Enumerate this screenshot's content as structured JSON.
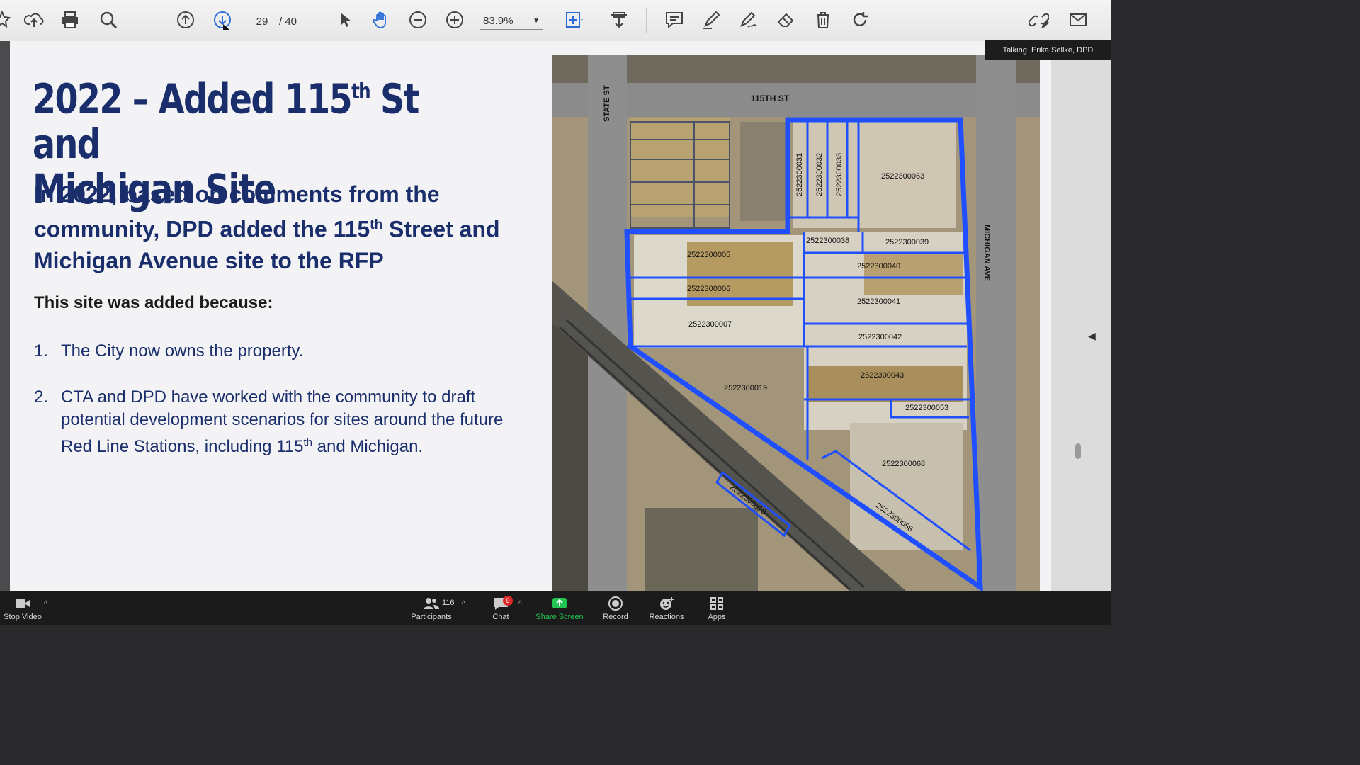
{
  "toolbar": {
    "page_current": "29",
    "page_total": "/ 40",
    "zoom": "83.9%"
  },
  "talking_indicator": "Talking: Erika Sellke, DPD",
  "slide": {
    "title_line1_a": "2022 – Added 115",
    "title_line1_sup": "th",
    "title_line1_b": " St and",
    "title_line2": "Michigan Site",
    "subtitle_a": "In 2022, based on comments from the community, DPD added the 115",
    "subtitle_sup": "th",
    "subtitle_b": " Street and Michigan Avenue site to the RFP",
    "reasons_heading": "This site was added because:",
    "reasons": [
      {
        "num": "1.",
        "text": "The City now owns the property."
      },
      {
        "num": "2.",
        "text_a": "CTA and DPD have worked with the community to draft potential development scenarios for sites around the future Red Line Stations, including 115",
        "sup": "th",
        "text_b": " and Michigan."
      }
    ]
  },
  "map": {
    "streets": [
      "115TH ST",
      "STATE ST",
      "MICHIGAN AVE"
    ],
    "parcels": [
      "2522300031",
      "2522300032",
      "2522300033",
      "2522300063",
      "2522300038",
      "2522300039",
      "2522300005",
      "2522300040",
      "2522300006",
      "2522300041",
      "2522300007",
      "2522300042",
      "2522300043",
      "2522300019",
      "2522300053",
      "2522300068",
      "2522300010",
      "2522300058"
    ]
  },
  "zoombar": {
    "stop_video": "Stop Video",
    "participants": "Participants",
    "participants_count": "116",
    "chat": "Chat",
    "chat_badge": "9",
    "share_screen": "Share Screen",
    "record": "Record",
    "reactions": "Reactions",
    "apps": "Apps"
  },
  "colors": {
    "title_navy": "#1a2e6c",
    "parcel_outline": "#1f4fff",
    "share_green": "#23c552",
    "badge_red": "#e02828"
  }
}
